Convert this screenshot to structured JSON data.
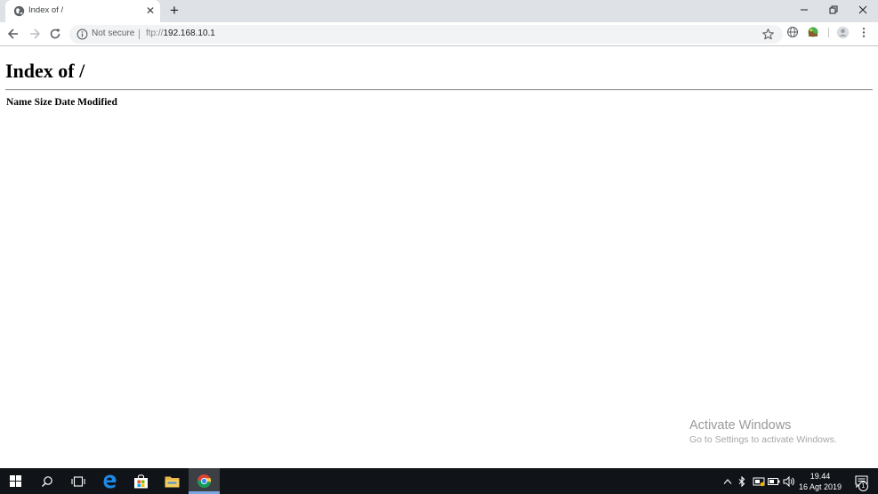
{
  "browser": {
    "tab": {
      "title": "Index of /",
      "icon": "globe-icon"
    },
    "new_tab_label": "+",
    "omnibox": {
      "security_label": "Not secure",
      "url_scheme": "ftp://",
      "url_host": "192.168.10.1"
    },
    "window_controls": [
      "minimize",
      "restore",
      "close"
    ]
  },
  "page": {
    "heading": "Index of /",
    "listing_columns": [
      "Name",
      "Size",
      "Date Modified"
    ],
    "rows": []
  },
  "watermark": {
    "title": "Activate Windows",
    "subtitle": "Go to Settings to activate Windows."
  },
  "taskbar": {
    "apps": [
      "start",
      "search",
      "task-view",
      "edge",
      "store",
      "file-explorer",
      "chrome"
    ],
    "active_app": "chrome",
    "clock": {
      "time": "19.44",
      "date": "16 Agt 2019"
    },
    "notification_count": "1"
  },
  "colors": {
    "tabstrip_bg": "#dee1e6",
    "omnibox_bg": "#f1f3f4",
    "taskbar_bg": "#101318",
    "chrome_active_underline": "#7aa7e0"
  }
}
